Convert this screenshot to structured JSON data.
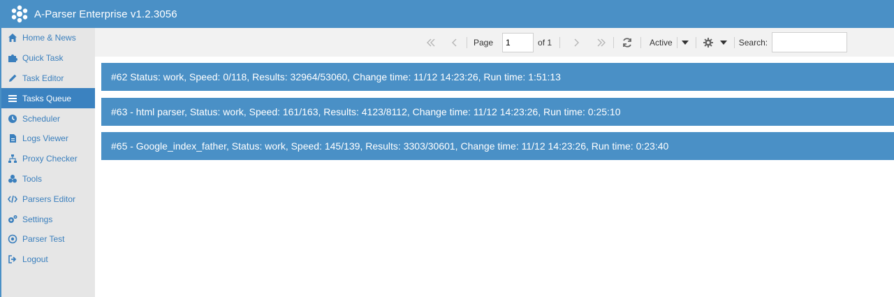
{
  "app": {
    "title": "A-Parser Enterprise v1.2.3056"
  },
  "sidebar": {
    "items": [
      {
        "label": "Home & News",
        "icon": "home-icon"
      },
      {
        "label": "Quick Task",
        "icon": "puzzle-icon"
      },
      {
        "label": "Task Editor",
        "icon": "pencil-icon"
      },
      {
        "label": "Tasks Queue",
        "icon": "list-icon",
        "active": true
      },
      {
        "label": "Scheduler",
        "icon": "clock-icon"
      },
      {
        "label": "Logs Viewer",
        "icon": "file-icon"
      },
      {
        "label": "Proxy Checker",
        "icon": "sitemap-icon"
      },
      {
        "label": "Tools",
        "icon": "cubes-icon"
      },
      {
        "label": "Parsers Editor",
        "icon": "code-icon"
      },
      {
        "label": "Settings",
        "icon": "cogs-icon"
      },
      {
        "label": "Parser Test",
        "icon": "target-icon"
      },
      {
        "label": "Logout",
        "icon": "sign-out-icon"
      }
    ]
  },
  "toolbar": {
    "page_label": "Page",
    "page_value": "1",
    "of_label": "of 1",
    "filter_label": "Active",
    "search_label": "Search:",
    "search_value": ""
  },
  "tasks": [
    "#62 Status: work, Speed: 0/118, Results: 32964/53060, Change time: 11/12 14:23:26, Run time: 1:51:13",
    "#63 - html parser, Status: work, Speed: 161/163, Results: 4123/8112, Change time: 11/12 14:23:26, Run time: 0:25:10",
    "#65 - Google_index_father, Status: work, Speed: 145/139, Results: 3303/30601, Change time: 11/12 14:23:26, Run time: 0:23:40"
  ],
  "colors": {
    "accent": "#4a90c6",
    "sidebar_active": "#3b82c0",
    "sidebar_text": "#3a7fbd",
    "sidebar_bg": "#e6e6e6",
    "toolbar_bg": "#f2f2f2"
  }
}
